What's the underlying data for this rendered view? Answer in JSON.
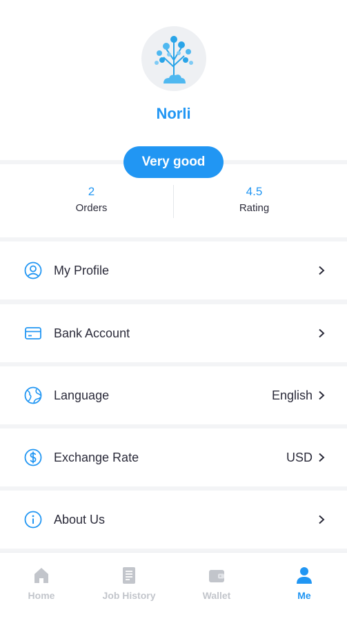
{
  "profile": {
    "name": "Norli",
    "badge": "Very good"
  },
  "stats": [
    {
      "value": "2",
      "label": "Orders"
    },
    {
      "value": "4.5",
      "label": "Rating"
    }
  ],
  "menu": [
    {
      "label": "My Profile",
      "value": "",
      "icon": "user-circle-icon"
    },
    {
      "label": "Bank Account",
      "value": "",
      "icon": "card-icon"
    },
    {
      "label": "Language",
      "value": "English",
      "icon": "globe-icon"
    },
    {
      "label": "Exchange Rate",
      "value": "USD",
      "icon": "dollar-icon"
    },
    {
      "label": "About Us",
      "value": "",
      "icon": "info-icon"
    }
  ],
  "tabs": [
    {
      "label": "Home",
      "icon": "home-icon",
      "active": false
    },
    {
      "label": "Job History",
      "icon": "document-icon",
      "active": false
    },
    {
      "label": "Wallet",
      "icon": "wallet-icon",
      "active": false
    },
    {
      "label": "Me",
      "icon": "person-icon",
      "active": true
    }
  ],
  "colors": {
    "accent": "#2196f3",
    "inactive": "#c2c5cb",
    "text": "#2b2b3a",
    "background": "#f3f4f6"
  }
}
